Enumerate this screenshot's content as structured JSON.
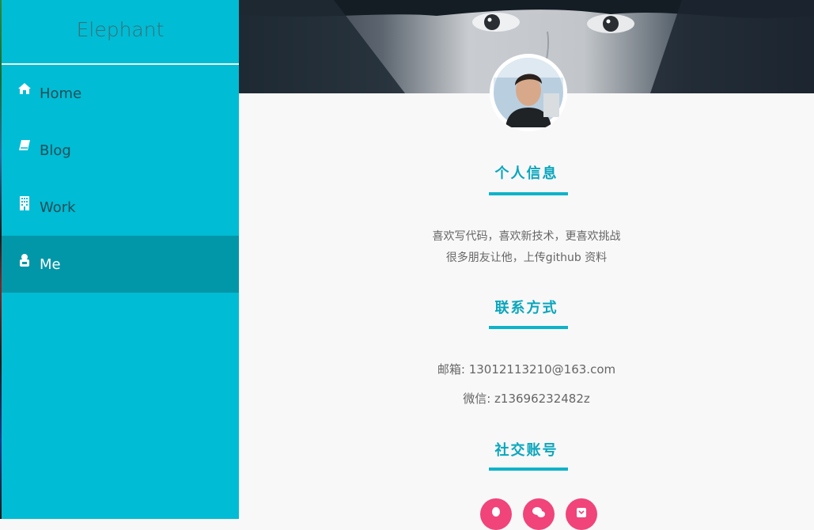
{
  "sidebar": {
    "brand": "Elephant",
    "items": [
      {
        "label": "Home",
        "icon": "home-icon"
      },
      {
        "label": "Blog",
        "icon": "book-icon"
      },
      {
        "label": "Work",
        "icon": "building-icon"
      },
      {
        "label": "Me",
        "icon": "user-icon",
        "active": true
      }
    ]
  },
  "profile": {
    "sections": [
      {
        "title": "个人信息"
      },
      {
        "title": "联系方式"
      },
      {
        "title": "社交账号"
      }
    ],
    "bio": [
      "喜欢写代码，喜欢新技术，更喜欢挑战",
      "很多朋友让他，上传github 资料"
    ],
    "contact": {
      "email": "邮箱: 13012113210@163.com",
      "wechat": "微信: z13696232482z"
    },
    "social": [
      {
        "icon": "qq-icon"
      },
      {
        "icon": "wechat-icon"
      },
      {
        "icon": "weibo-icon"
      }
    ]
  },
  "colors": {
    "sidebar": "#00bcd4",
    "sidebar_active": "#0197a9",
    "accent": "#0fb3c9",
    "social": "#f0447a"
  }
}
